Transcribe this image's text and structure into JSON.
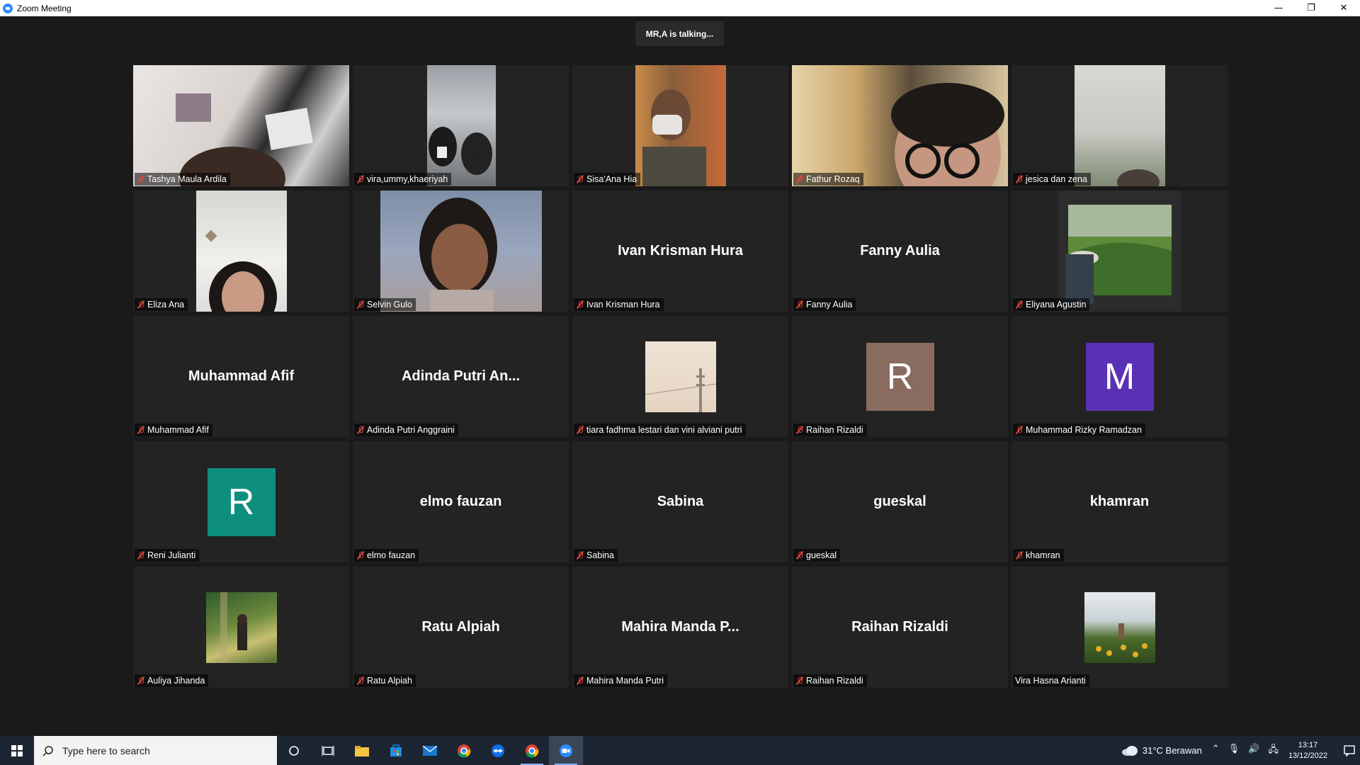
{
  "window": {
    "title": "Zoom Meeting",
    "minimize_glyph": "—",
    "restore_glyph": "❐",
    "close_glyph": "✕"
  },
  "meeting": {
    "talking_indicator": "MR,A is talking..."
  },
  "colors": {
    "mute_red": "#e0453e",
    "avatar_brown": "#8a6b5f",
    "avatar_purple": "#5a31b5",
    "avatar_teal": "#0e8f7e"
  },
  "participants": [
    {
      "name": "Tashya Maula Ardila",
      "display": "video",
      "muted": true
    },
    {
      "name": "vira,ummy,khaeriyah",
      "display": "video",
      "muted": true
    },
    {
      "name": "Sisa'Ana Hia",
      "display": "video",
      "muted": true
    },
    {
      "name": "Fathur Rozaq",
      "display": "video",
      "muted": true
    },
    {
      "name": "jesica dan zena",
      "display": "video",
      "muted": true
    },
    {
      "name": "Eliza Ana",
      "display": "video",
      "muted": true
    },
    {
      "name": "Selvin Gulo",
      "display": "video",
      "muted": true
    },
    {
      "name": "Ivan Krisman Hura",
      "display": "name",
      "center_text": "Ivan Krisman Hura",
      "muted": true
    },
    {
      "name": "Fanny Aulia",
      "display": "name",
      "center_text": "Fanny Aulia",
      "muted": true
    },
    {
      "name": "Eliyana Agustin",
      "display": "video",
      "muted": true
    },
    {
      "name": "Muhammad Afif",
      "display": "name",
      "center_text": "Muhammad Afif",
      "muted": true
    },
    {
      "name": "Adinda Putri Anggraini",
      "display": "name",
      "center_text": "Adinda Putri An...",
      "muted": true
    },
    {
      "name": "tiara fadhma lestari dan vini alviani putri",
      "display": "photo",
      "muted": true
    },
    {
      "name": "Raihan Rizaldi",
      "display": "avatar",
      "initial": "R",
      "muted": true
    },
    {
      "name": "Muhammad Rizky Ramadzan",
      "display": "avatar",
      "initial": "M",
      "muted": true
    },
    {
      "name": "Reni Julianti",
      "display": "avatar",
      "initial": "R",
      "muted": true
    },
    {
      "name": "elmo fauzan",
      "display": "name",
      "center_text": "elmo fauzan",
      "muted": true
    },
    {
      "name": "Sabina",
      "display": "name",
      "center_text": "Sabina",
      "muted": true
    },
    {
      "name": "gueskal",
      "display": "name",
      "center_text": "gueskal",
      "muted": true
    },
    {
      "name": "khamran",
      "display": "name",
      "center_text": "khamran",
      "muted": true
    },
    {
      "name": "Auliya Jihanda",
      "display": "photo",
      "muted": true
    },
    {
      "name": "Ratu Alpiah",
      "display": "name",
      "center_text": "Ratu Alpiah",
      "muted": true
    },
    {
      "name": "Mahira Manda Putri",
      "display": "name",
      "center_text": "Mahira Manda P...",
      "muted": true
    },
    {
      "name": "Raihan Rizaldi",
      "display": "name",
      "center_text": "Raihan Rizaldi",
      "muted": true
    },
    {
      "name": "Vira Hasna Arianti",
      "display": "photo",
      "muted": false
    }
  ],
  "taskbar": {
    "search_placeholder": "Type here to search",
    "weather": "31°C  Berawan",
    "time": "13:17",
    "date": "13/12/2022"
  }
}
